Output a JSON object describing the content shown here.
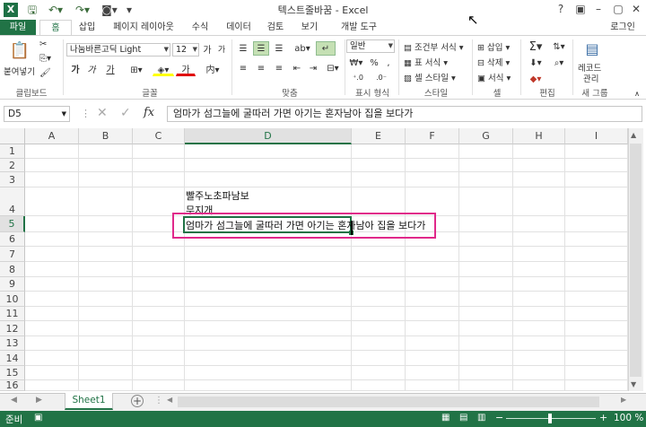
{
  "titlebar": {
    "app_icon": "excel-logo-icon",
    "title": "텍스트줄바꿈 - Excel",
    "help": "?",
    "minimize": "–",
    "restore": "▢",
    "close": "✕"
  },
  "ribbon_tabs": {
    "file": "파일",
    "home": "홈",
    "insert": "삽입",
    "page_layout": "페이지 레이아웃",
    "formulas": "수식",
    "data": "데이터",
    "review": "검토",
    "view": "보기",
    "developer": "개발 도구",
    "sign_in": "로그인"
  },
  "ribbon": {
    "clipboard": {
      "paste": "붙여넣기",
      "label": "클립보드"
    },
    "font": {
      "font_name": "나눔바른고딕 Light",
      "font_size": "12",
      "bold": "가",
      "italic": "가",
      "underline": "가",
      "grow": "가",
      "shrink": "가",
      "font_color_glyph": "가",
      "label": "글꼴"
    },
    "alignment": {
      "label": "맞춤"
    },
    "number": {
      "format": "일반",
      "percent": "%",
      "label": "표시 형식"
    },
    "styles": {
      "conditional": "조건부 서식",
      "table": "표 서식",
      "cell_styles": "셀 스타일",
      "label": "스타일"
    },
    "cells": {
      "insert": "삽입",
      "delete": "삭제",
      "format": "서식",
      "label": "셀"
    },
    "editing": {
      "label": "편집"
    },
    "records": {
      "line1": "레코드",
      "line2": "관리",
      "label": "새 그룹"
    }
  },
  "formula_bar": {
    "name_box": "D5",
    "fx": "fx",
    "content": "엄마가 섬그늘에 굴따러 가면 아기는 혼자남아 집을 보다가"
  },
  "grid": {
    "columns": [
      "A",
      "B",
      "C",
      "D",
      "E",
      "F",
      "G",
      "H",
      "I"
    ],
    "rows": [
      "1",
      "2",
      "3",
      "4",
      "5",
      "6",
      "7",
      "8",
      "9",
      "10",
      "11",
      "12",
      "13",
      "14",
      "15",
      "16"
    ],
    "cells": {
      "D4_line1": "빨주노초파남보",
      "D4_line2": "무지개",
      "D5": "엄마가 섬그늘에 굴따러 가면 아기는 혼자남아 집을 보다가"
    }
  },
  "sheet_tabs": {
    "active": "Sheet1",
    "add": "+"
  },
  "statusbar": {
    "mode": "준비",
    "zoom": "100 %"
  },
  "colors": {
    "accent": "#217346",
    "highlight_border": "#e0298a"
  }
}
